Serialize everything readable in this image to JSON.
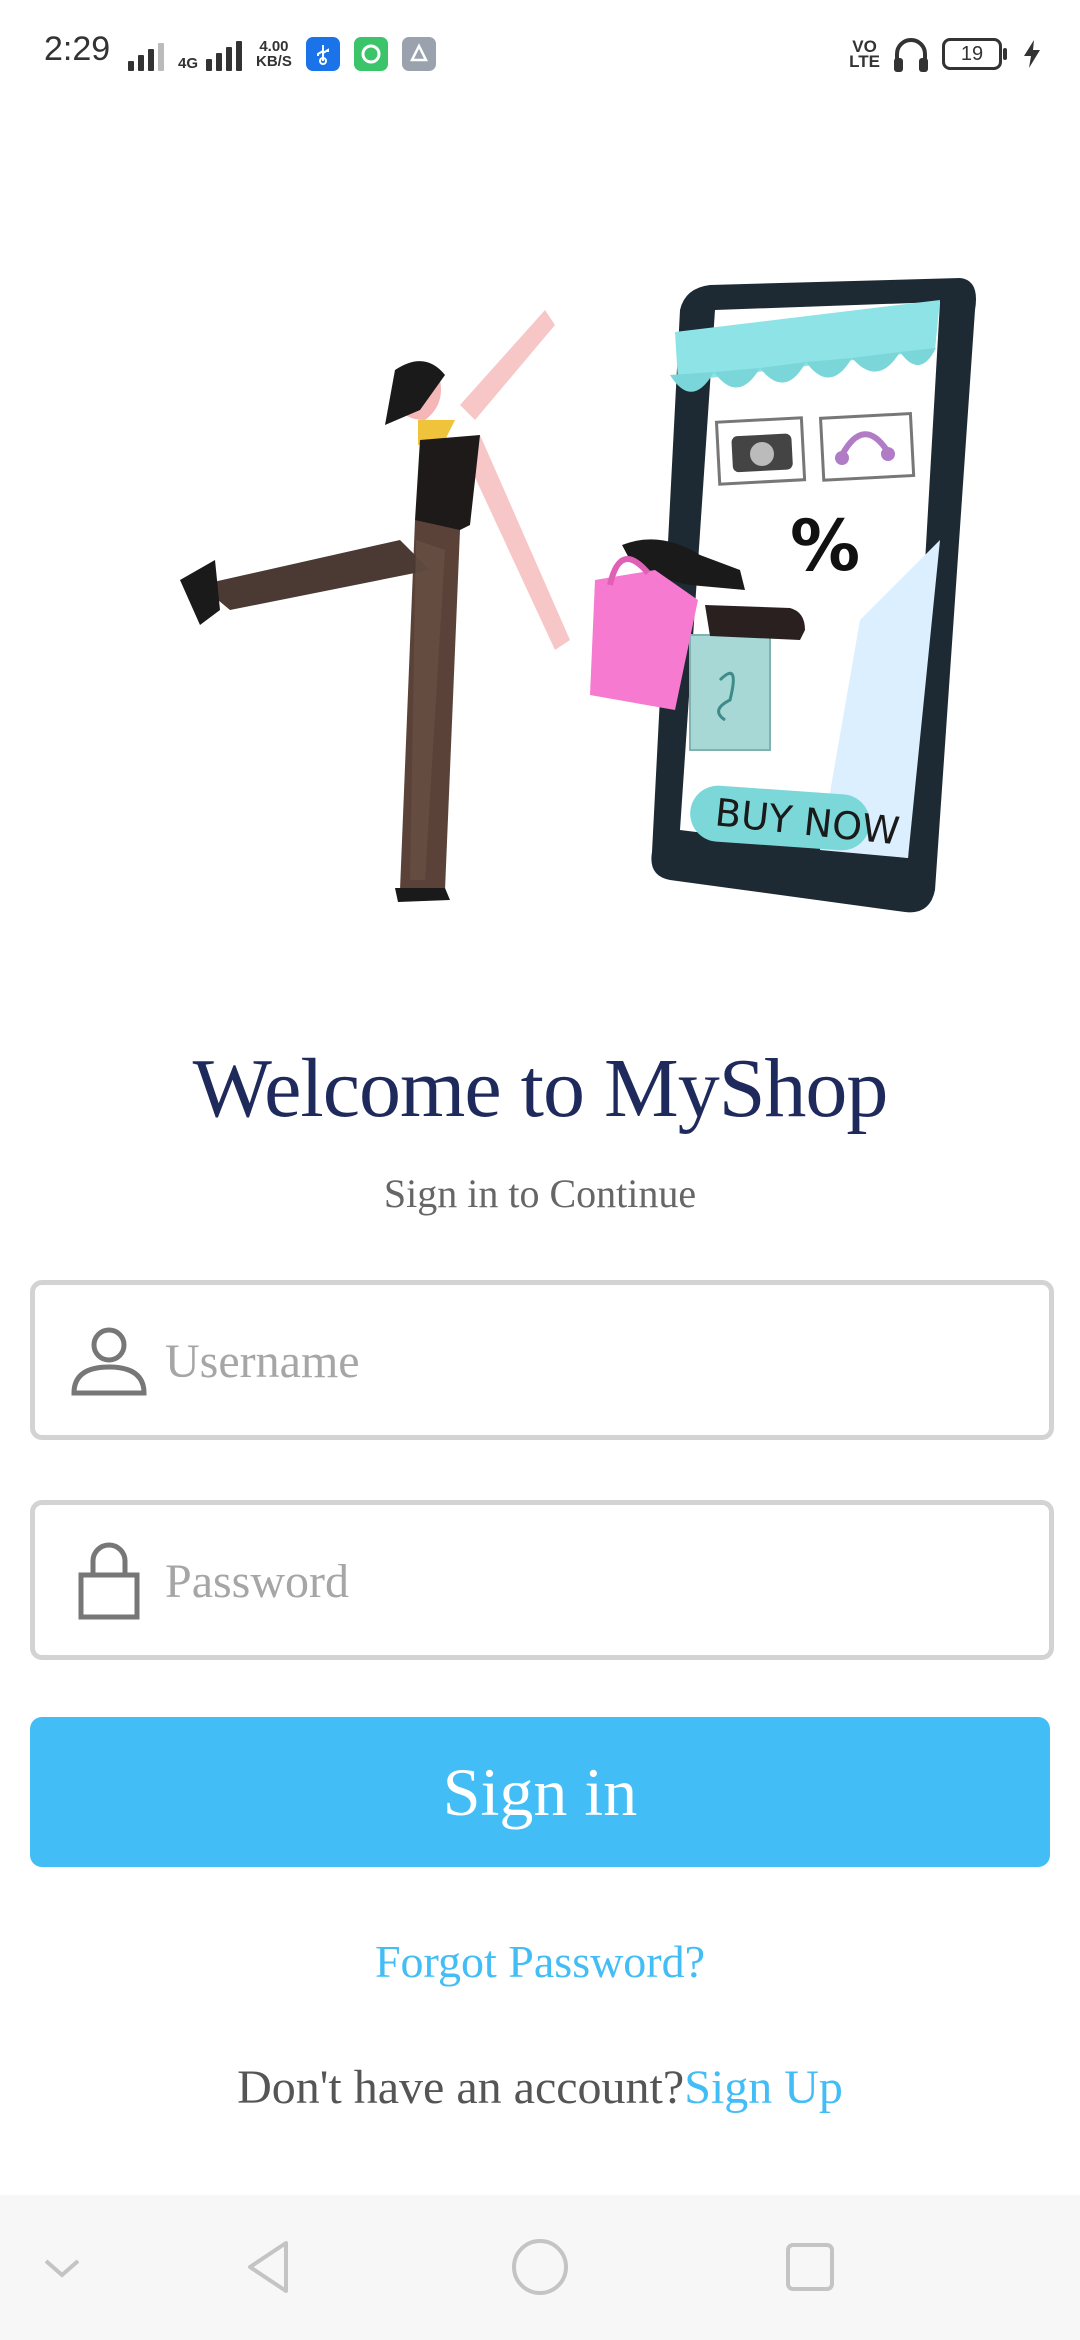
{
  "status_bar": {
    "time": "2:29",
    "network_type": "4G",
    "speed_value": "4.00",
    "speed_unit": "KB/S",
    "volte_top": "VO",
    "volte_bottom": "LTE",
    "battery": "19",
    "icons": [
      "signal-icon",
      "wifi-icon",
      "signal-4g-icon",
      "usb-icon",
      "chat-app-icon",
      "share-app-icon",
      "volte-icon",
      "headphones-icon",
      "battery-icon",
      "charging-icon"
    ]
  },
  "illustration": {
    "sign_text": "BUY NOW",
    "discount_symbol": "%"
  },
  "login": {
    "title": "Welcome to MyShop",
    "subtitle": "Sign in to Continue",
    "username_placeholder": "Username",
    "password_placeholder": "Password",
    "signin_label": "Sign in",
    "forgot_label": "Forgot Password?",
    "no_account_text": "Don't have an account?",
    "signup_label": "Sign Up"
  },
  "nav_bar": {
    "icons": [
      "collapse-chevron-icon",
      "back-icon",
      "home-icon",
      "recents-icon"
    ]
  },
  "colors": {
    "title": "#1f2a5c",
    "accent": "#42bdf6",
    "placeholder": "#a6a6a6",
    "border": "#d3d3d3"
  }
}
